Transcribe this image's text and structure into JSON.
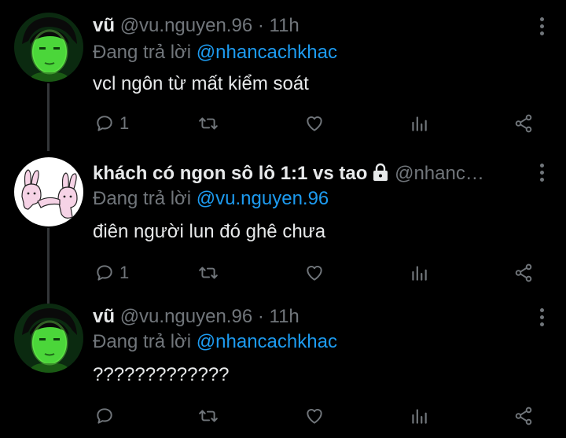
{
  "colors": {
    "background": "#000000",
    "text": "#e7e9ea",
    "muted": "#71767b",
    "link": "#1d9bf0"
  },
  "tweets": [
    {
      "name": "vũ",
      "handle": "@vu.nguyen.96",
      "separator": "·",
      "time": "11h",
      "reply_prefix": "Đang trả lời",
      "reply_to": "@nhancachkhac",
      "text": "vcl ngôn từ mất kiểm soát",
      "reply_count": "1",
      "avatar": "green-face-avatar"
    },
    {
      "name": "khách có ngon sô lô 1:1 vs tao",
      "handle": "@nhanc…",
      "locked": true,
      "reply_prefix": "Đang trả lời",
      "reply_to": "@vu.nguyen.96",
      "text": "điên người lun đó ghê chưa",
      "reply_count": "1",
      "avatar": "bunny-cartoon-avatar"
    },
    {
      "name": "vũ",
      "handle": "@vu.nguyen.96",
      "separator": "·",
      "time": "11h",
      "reply_prefix": "Đang trả lời",
      "reply_to": "@nhancachkhac",
      "text": "?????????????",
      "reply_count": "",
      "avatar": "green-face-avatar"
    }
  ]
}
